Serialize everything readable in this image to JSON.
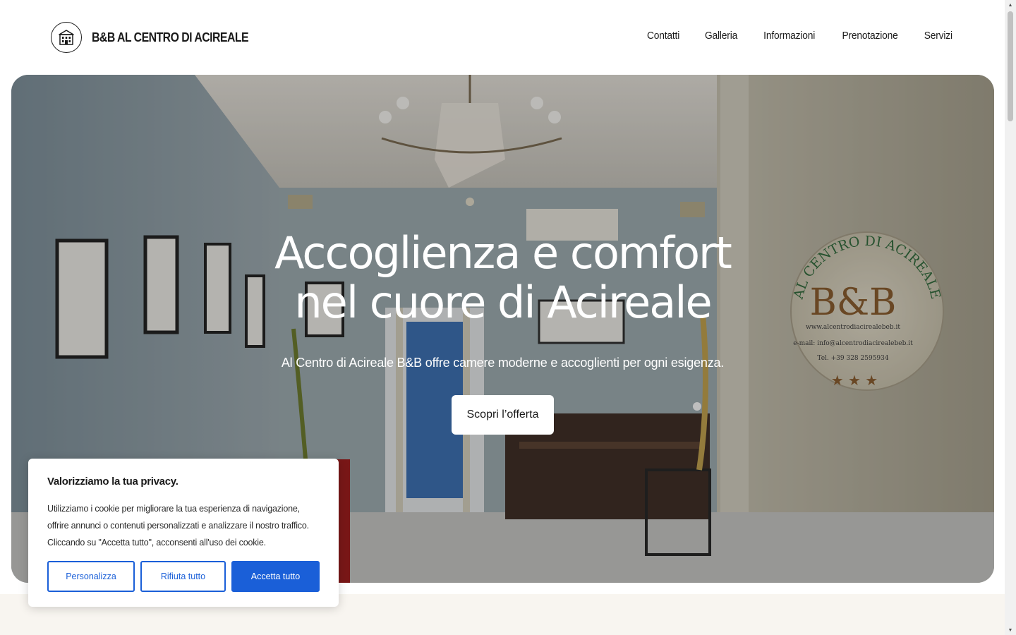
{
  "header": {
    "logo_icon": "building-icon",
    "brand": "B&B AL CENTRO DI ACIREALE",
    "nav": [
      {
        "label": "Contatti"
      },
      {
        "label": "Galleria"
      },
      {
        "label": "Informazioni"
      },
      {
        "label": "Prenotazione"
      },
      {
        "label": "Servizi"
      }
    ]
  },
  "hero": {
    "title_line1": "Accoglienza e comfort",
    "title_line2": "nel cuore di Acireale",
    "subtitle": "Al Centro di Acireale B&B offre camere moderne e accoglienti per ogni esigenza.",
    "cta": "Scopri l’offerta",
    "sign_arc": "AL CENTRO DI ACIREALE",
    "sign_main": "B&B",
    "sign_line1": "www.alcentrodiacirealebeb.it",
    "sign_line2": "e-mail: info@alcentrodiacirealebeb.it",
    "sign_line3": "Tel. +39 328 2595934"
  },
  "cookie": {
    "title": "Valorizziamo la tua privacy.",
    "text": "Utilizziamo i cookie per migliorare la tua esperienza di navigazione, offrire annunci o contenuti personalizzati e analizzare il nostro traffico. Cliccando su \"Accetta tutto\", acconsenti all'uso dei cookie.",
    "btn_customize": "Personalizza",
    "btn_reject": "Rifiuta tutto",
    "btn_accept": "Accetta tutto"
  },
  "colors": {
    "accent": "#1a5fd8",
    "band": "#f8f5f0"
  }
}
